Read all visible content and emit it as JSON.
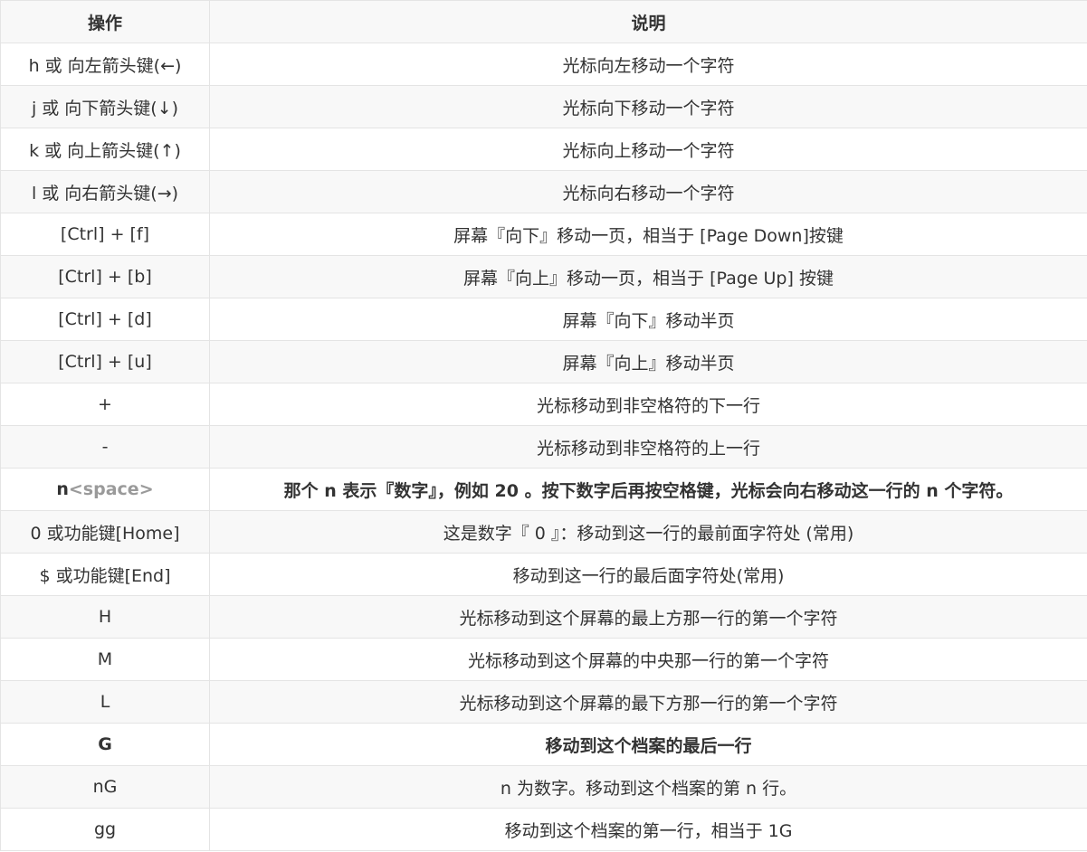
{
  "table": {
    "headers": [
      "操作",
      "说明"
    ],
    "rows": [
      {
        "op": "h 或 向左箭头键(←)",
        "desc": "光标向左移动一个字符"
      },
      {
        "op": "j 或 向下箭头键(↓)",
        "desc": "光标向下移动一个字符"
      },
      {
        "op": "k 或 向上箭头键(↑)",
        "desc": "光标向上移动一个字符"
      },
      {
        "op": "l 或 向右箭头键(→)",
        "desc": "光标向右移动一个字符"
      },
      {
        "op": "[Ctrl] + [f]",
        "desc": "屏幕『向下』移动一页，相当于 [Page Down]按键"
      },
      {
        "op": "[Ctrl] + [b]",
        "desc": "屏幕『向上』移动一页，相当于 [Page Up] 按键"
      },
      {
        "op": "[Ctrl] + [d]",
        "desc": "屏幕『向下』移动半页"
      },
      {
        "op": "[Ctrl] + [u]",
        "desc": "屏幕『向上』移动半页"
      },
      {
        "op": "+",
        "desc": "光标移动到非空格符的下一行"
      },
      {
        "op": "-",
        "desc": "光标移动到非空格符的上一行"
      },
      {
        "op_main": "n",
        "op_sub": "<space>",
        "desc": "那个 n 表示『数字』，例如 20 。按下数字后再按空格键，光标会向右移动这一行的 n 个字符。"
      },
      {
        "op": "0 或功能键[Home]",
        "desc": "这是数字『 0 』：移动到这一行的最前面字符处 (常用)"
      },
      {
        "op": "$ 或功能键[End]",
        "desc": "移动到这一行的最后面字符处(常用)"
      },
      {
        "op": "H",
        "desc": "光标移动到这个屏幕的最上方那一行的第一个字符"
      },
      {
        "op": "M",
        "desc": "光标移动到这个屏幕的中央那一行的第一个字符"
      },
      {
        "op": "L",
        "desc": "光标移动到这个屏幕的最下方那一行的第一个字符"
      },
      {
        "op": "G",
        "desc": "移动到这个档案的最后一行"
      },
      {
        "op": "nG",
        "desc": "n 为数字。移动到这个档案的第 n 行。"
      },
      {
        "op": "gg",
        "desc": "移动到这个档案的第一行，相当于 1G"
      }
    ]
  }
}
